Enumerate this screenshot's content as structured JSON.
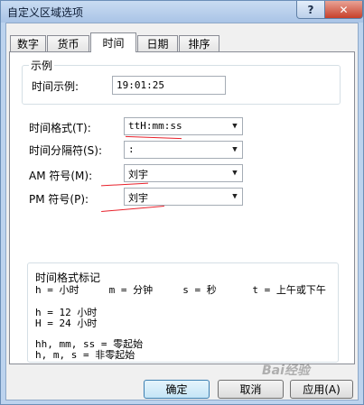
{
  "window": {
    "title": "自定义区域选项",
    "help_label": "?",
    "close_label": "✕"
  },
  "tabs": [
    {
      "label": "数字",
      "active": false
    },
    {
      "label": "货币",
      "active": false
    },
    {
      "label": "时间",
      "active": true
    },
    {
      "label": "日期",
      "active": false
    },
    {
      "label": "排序",
      "active": false
    }
  ],
  "example": {
    "group_label": "示例",
    "field_label": "时间示例:",
    "value": "19:01:25"
  },
  "fields": {
    "time_format_label": "时间格式(T):",
    "time_format_value": "ttH:mm:ss",
    "separator_label": "时间分隔符(S):",
    "separator_value": ":",
    "am_label": "AM 符号(M):",
    "am_value": "刘宇",
    "pm_label": "PM 符号(P):",
    "pm_value": "刘宇"
  },
  "notes": {
    "title": "时间格式标记",
    "line1": "h = 小时     m = 分钟     s = 秒      t = 上午或下午",
    "line2": "h = 12 小时",
    "line3": "H = 24 小时",
    "line4": "hh, mm, ss = 零起始",
    "line5": "h, m, s = 非零起始"
  },
  "buttons": {
    "ok": "确定",
    "cancel": "取消",
    "apply": "应用(A)"
  },
  "watermark": "Bai经验",
  "colors": {
    "annotation_red": "#e8202a",
    "title_bar": "#bcd3ee",
    "close_button": "#c7402a"
  }
}
